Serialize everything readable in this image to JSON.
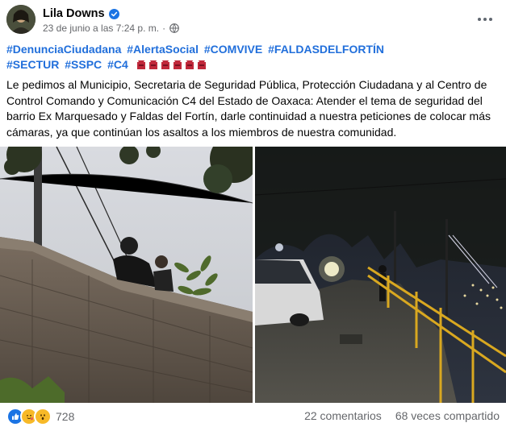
{
  "post": {
    "author": "Lila Downs",
    "timestamp": "23 de junio a las 7:24 p. m.",
    "separator": "·",
    "hashtags": [
      "#DenunciaCiudadana",
      "#AlertaSocial",
      "#COMVIVE",
      "#FALDASDELFORTÍN",
      "#SECTUR",
      "#SSPC",
      "#C4"
    ],
    "flag_emoji_count": 6,
    "body": "Le pedimos al Municipio, Secretaria de Seguridad Pública, Protección Ciudadana y al Centro de Control Comando y Comunicación C4 del Estado de Oaxaca: Atender el tema de seguridad del barrio Ex Marquesado y Faldas del Fortín, darle continuidad a nuestra peticiones de colocar más cámaras, ya que continúan los asaltos a los miembros de nuestra comunidad."
  },
  "footer": {
    "reaction_count": "728",
    "comments": "22 comentarios",
    "shares": "68 veces compartido"
  },
  "icons": {
    "verified": "verified-badge-icon",
    "privacy": "globe-icon",
    "more": "more-options-icon",
    "reactions": [
      "like-icon",
      "care-icon",
      "wow-icon"
    ]
  },
  "colors": {
    "hashtag": "#216fdb",
    "verified": "#1b74e4",
    "secondary_text": "#65676b"
  }
}
